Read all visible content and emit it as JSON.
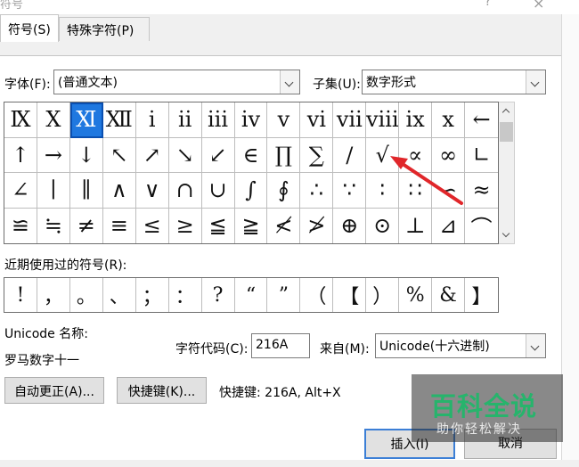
{
  "window": {
    "title": "符号",
    "help": "?",
    "close": "×"
  },
  "tabs": [
    {
      "label": "符号(S)",
      "active": true
    },
    {
      "label": "特殊字符(P)",
      "active": false
    }
  ],
  "font": {
    "label": "字体(F):",
    "value": "(普通文本)"
  },
  "subset": {
    "label": "子集(U):",
    "value": "数字形式"
  },
  "symbols_grid": {
    "selected_index": 2,
    "rows": [
      [
        "Ⅸ",
        "Ⅹ",
        "Ⅺ",
        "Ⅻ",
        "ⅰ",
        "ⅱ",
        "ⅲ",
        "ⅳ",
        "ⅴ",
        "ⅵ",
        "ⅶ",
        "ⅷ",
        "ⅸ",
        "ⅹ",
        "←"
      ],
      [
        "↑",
        "→",
        "↓",
        "↖",
        "↗",
        "↘",
        "↙",
        "∈",
        "∏",
        "∑",
        "∕",
        "√",
        "∝",
        "∞",
        "∟"
      ],
      [
        "∠",
        "∣",
        "∥",
        "∧",
        "∨",
        "∩",
        "∪",
        "∫",
        "∮",
        "∴",
        "∵",
        "∶",
        "∷",
        "∽",
        "≈"
      ],
      [
        "≌",
        "≒",
        "≠",
        "≡",
        "≤",
        "≥",
        "≦",
        "≧",
        "≮",
        "≯",
        "⊕",
        "⊙",
        "⊥",
        "⊿",
        "⌒"
      ]
    ]
  },
  "recent": {
    "label": "近期使用过的符号(R):",
    "symbols": [
      "!",
      "，",
      "。",
      "、",
      "；",
      "：",
      "?",
      "“",
      "”",
      "（",
      "【",
      "）",
      "%",
      "&",
      "】"
    ]
  },
  "unicode_name": {
    "label": "Unicode 名称:",
    "value": "罗马数字十一"
  },
  "char_code": {
    "label": "字符代码(C):",
    "value": "216A"
  },
  "from": {
    "label": "来自(M):",
    "value": "Unicode(十六进制)"
  },
  "buttons": {
    "autocorrect": "自动更正(A)...",
    "shortcut_key": "快捷键(K)...",
    "shortcut_text": "快捷键: 216A, Alt+X",
    "insert": "插入(I)",
    "cancel": "取消"
  },
  "watermark": {
    "main": "百科全说",
    "sub": "助你轻松解决"
  },
  "colors": {
    "selection": "#1f78e0",
    "annotation_arrow": "#e0262a",
    "watermark_green": "#27b46c"
  }
}
